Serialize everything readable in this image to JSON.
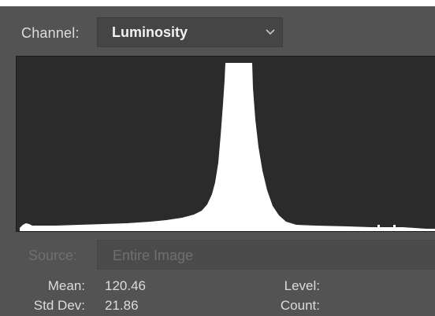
{
  "channel": {
    "label": "Channel:",
    "value": "Luminosity",
    "dropdown_icon": "chevron-down-icon"
  },
  "source": {
    "label": "Source:",
    "value": "Entire Image"
  },
  "stats": {
    "mean_label": "Mean:",
    "mean_value": "120.46",
    "stddev_label": "Std Dev:",
    "stddev_value": "21.86",
    "level_label": "Level:",
    "count_label": "Count:"
  },
  "colors": {
    "panel_bg": "#535353",
    "histogram_bg": "#2b2b2b",
    "histogram_fill": "#ffffff",
    "text": "#dcdcdc",
    "disabled_text": "#6f6f6f"
  }
}
